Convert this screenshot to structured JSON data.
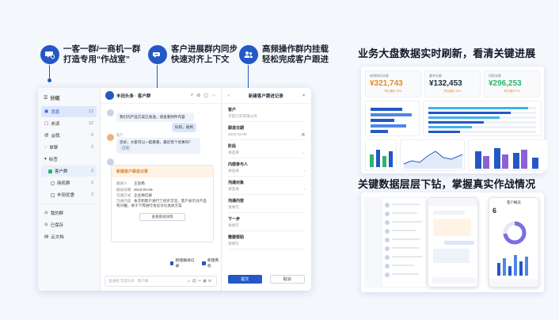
{
  "features": [
    {
      "icon": "chat-group-icon",
      "line1": "一客一群/一商机一群",
      "line2": "打造专用“作战室”"
    },
    {
      "icon": "sync-icon",
      "line1": "客户进展群内同步",
      "line2": "快速对齐上下文"
    },
    {
      "icon": "team-icon",
      "line1": "高频操作群内挂载",
      "line2": "轻松完成客户跟进"
    }
  ],
  "right_titles": {
    "dashboard": "业务大盘数据实时刷新，看清关键进展",
    "drill": "关键数据层层下钻，掌握真实作战情况"
  },
  "app": {
    "sidebar": {
      "header": "分组",
      "items": [
        {
          "label": "消息",
          "count": "12"
        },
        {
          "label": "未读",
          "count": "12"
        },
        {
          "label": "@我",
          "count": "5"
        },
        {
          "label": "单聊",
          "count": "2"
        },
        {
          "label": "标签",
          "count": ""
        },
        {
          "label": "客户群",
          "count": "2"
        },
        {
          "label": "商机群",
          "count": "2"
        },
        {
          "label": "丰田优惠",
          "count": "2"
        },
        {
          "label": "我的群",
          "count": ""
        },
        {
          "label": "已保存",
          "count": ""
        },
        {
          "label": "云文档",
          "count": ""
        }
      ]
    },
    "chat": {
      "title": "丰田头条 · 客户群",
      "msg1": "我们的产品方案已发送，请查看附件内容",
      "msg2": "好的，收到",
      "msg3_name": "客户",
      "msg3": "您好，大家可以一起看看，最近有个优惠吗？",
      "msg3_tag": "已读",
      "card_header": "新建客户跟进记录",
      "card_rows": [
        {
          "k": "跟进人",
          "v": "王思杨"
        },
        {
          "k": "跟进日期",
          "v": "2023-03-09"
        },
        {
          "k": "沟通方式",
          "v": "企业微信群"
        },
        {
          "k": "沟通内容",
          "v": "本次和客户进行了初步交流，客户表示对产品有兴趣，将于下周进行会议讨论具体方案"
        }
      ],
      "card_button": "查看跟进详情",
      "action1": "新建跟进记录",
      "action2": "新建商机",
      "input_placeholder": "发送给 丰田头条 · 客户群"
    },
    "form": {
      "title": "新建客户跟进记录",
      "fields": [
        {
          "label": "客户",
          "value": "丰田汽车有限公司"
        },
        {
          "label": "跟进日期",
          "value": "2023-03-09"
        },
        {
          "label": "阶段",
          "value": "请选择"
        },
        {
          "label": "内部参与人",
          "value": "请选择"
        },
        {
          "label": "沟通对象",
          "value": "请选择"
        },
        {
          "label": "沟通内容",
          "value": "请填写"
        },
        {
          "label": "下一步",
          "value": "请填写"
        },
        {
          "label": "需要帮助",
          "value": "请填写"
        }
      ],
      "submit": "提交",
      "cancel": "取消"
    }
  },
  "dashboard": {
    "kpis": [
      {
        "name": "新增商机金额",
        "value": "¥321,743",
        "sub": "环比增长 18%",
        "color": "#e08d2d"
      },
      {
        "name": "赢单金额",
        "value": "¥132,453",
        "sub": "环比增长 12%",
        "color": "#1f2d3d"
      },
      {
        "name": "回款金额",
        "value": "¥296,253",
        "sub": "环比增长 9%",
        "color": "#2fb36c"
      }
    ]
  },
  "drill_card": {
    "header": "客户概览",
    "big": "6"
  }
}
